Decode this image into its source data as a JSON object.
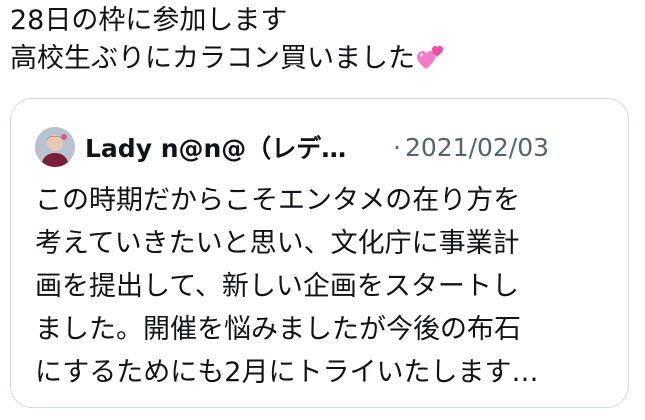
{
  "tweet": {
    "lines": [
      "28日の枠に参加します",
      "高校生ぶりにカラコン買いました"
    ],
    "emoji": "two-hearts-emoji"
  },
  "quote": {
    "author_name": "Lady n@n@（レデ…",
    "separator": "·",
    "date": "2021/02/03",
    "avatar": "avatar-photo",
    "body_lines": [
      "この時期だからこそエンタメの在り方を",
      "考えていきたいと思い、文化庁に事業計",
      "画を提出して、新しい企画をスタートし",
      "ました。開催を悩みましたが今後の布石",
      "にするためにも2月にトライいたします…"
    ]
  },
  "colors": {
    "text": "#0f1419",
    "secondary": "#536471",
    "border": "#cfd9de",
    "heart": "#f27cc5"
  }
}
